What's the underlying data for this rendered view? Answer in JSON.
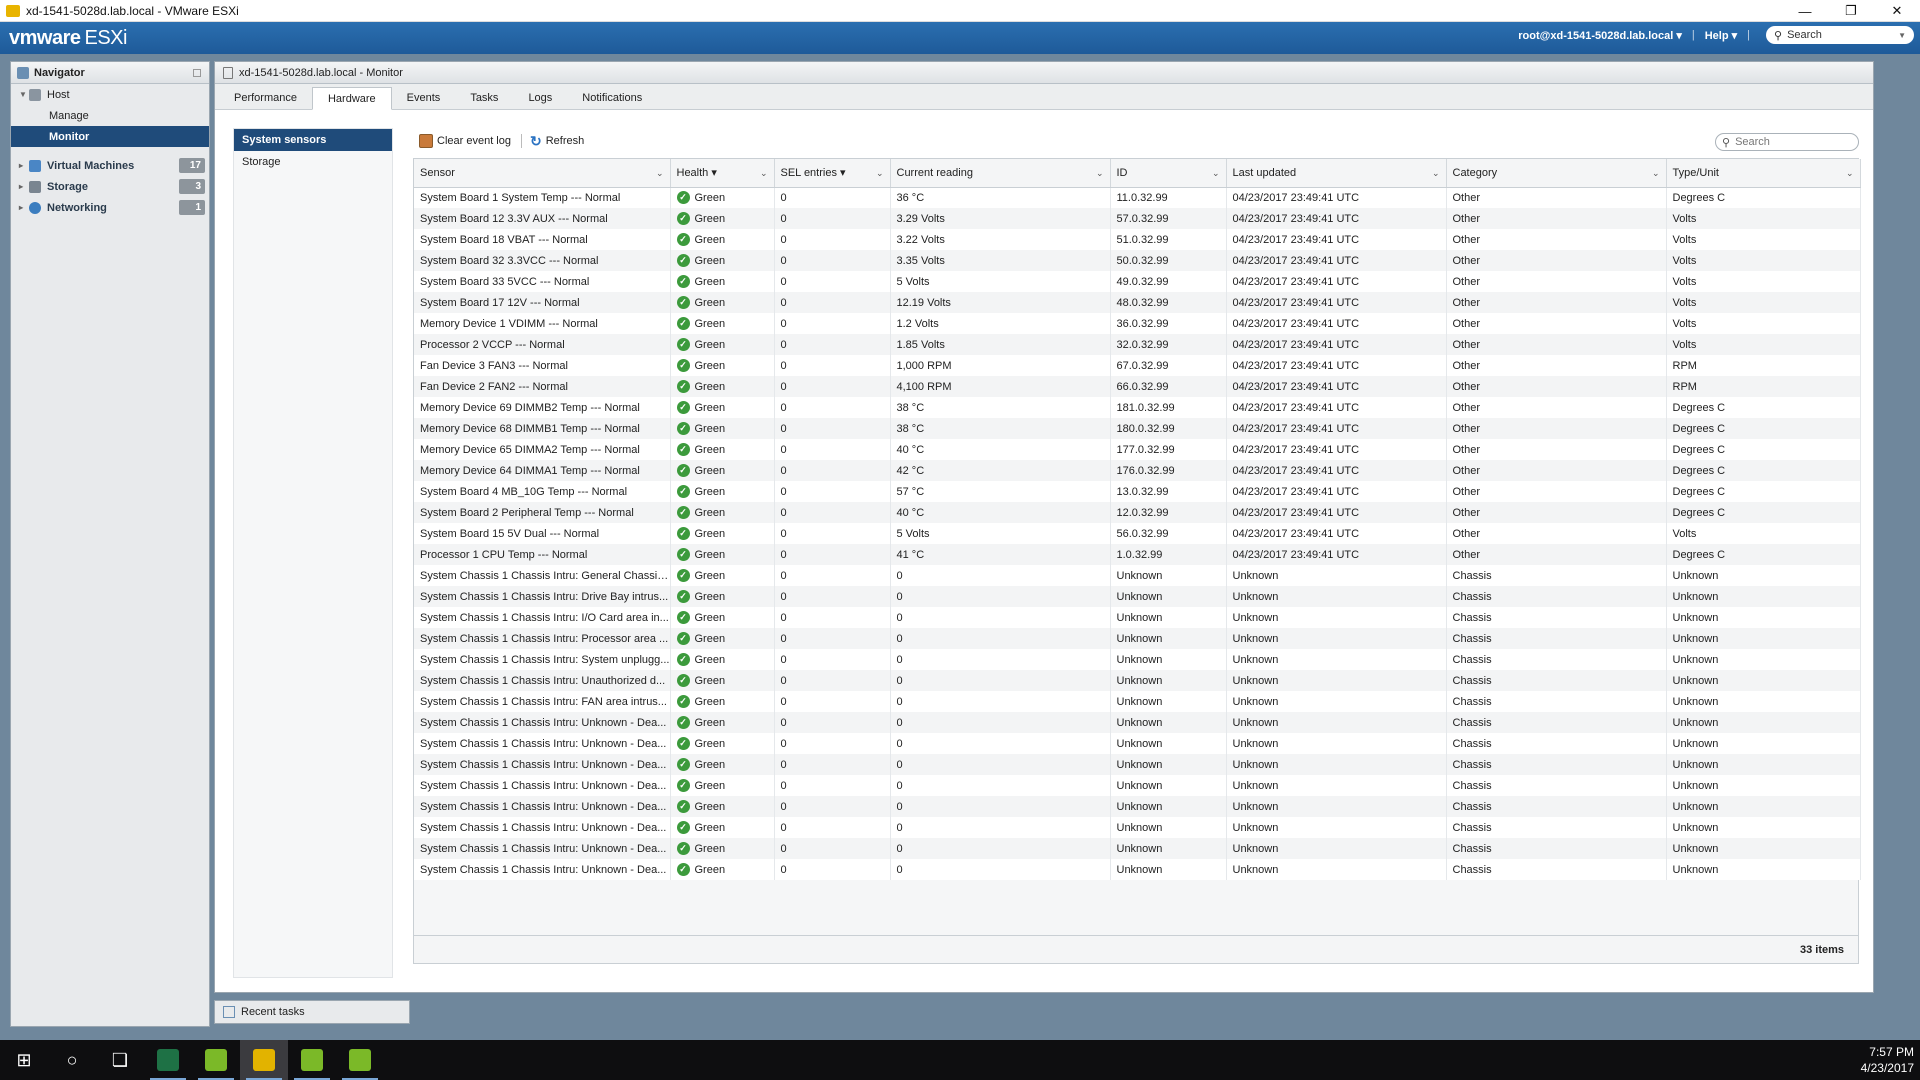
{
  "window": {
    "title": "xd-1541-5028d.lab.local - VMware ESXi",
    "controls": [
      "—",
      "❐",
      "✕"
    ]
  },
  "header": {
    "logo": "vmware",
    "product": "ESXi",
    "user": "root@xd-1541-5028d.lab.local ▾",
    "help": "Help ▾",
    "search_placeholder": "Search"
  },
  "navigator": {
    "title": "Navigator",
    "host": "Host",
    "host_items": [
      "Manage",
      "Monitor"
    ],
    "groups": [
      {
        "label": "Virtual Machines",
        "count": "17",
        "color": "#4a86c5"
      },
      {
        "label": "Storage",
        "count": "3",
        "color": "#7a8590"
      },
      {
        "label": "Networking",
        "count": "1",
        "color": "#3b7dbf"
      }
    ]
  },
  "main": {
    "title": "xd-1541-5028d.lab.local - Monitor",
    "tabs": [
      "Performance",
      "Hardware",
      "Events",
      "Tasks",
      "Logs",
      "Notifications"
    ],
    "side_items": [
      "System sensors",
      "Storage"
    ],
    "toolbar": {
      "clear": "Clear event log",
      "refresh": "Refresh",
      "search_placeholder": "Search"
    },
    "columns": [
      "Sensor",
      "Health ▾",
      "SEL entries ▾",
      "Current reading",
      "ID",
      "Last updated",
      "Category",
      "Type/Unit"
    ],
    "rows": [
      [
        "System Board 1 System Temp --- Normal",
        "Green",
        "0",
        "36 °C",
        "11.0.32.99",
        "04/23/2017 23:49:41 UTC",
        "Other",
        "Degrees C"
      ],
      [
        "System Board 12 3.3V AUX --- Normal",
        "Green",
        "0",
        "3.29 Volts",
        "57.0.32.99",
        "04/23/2017 23:49:41 UTC",
        "Other",
        "Volts"
      ],
      [
        "System Board 18 VBAT --- Normal",
        "Green",
        "0",
        "3.22 Volts",
        "51.0.32.99",
        "04/23/2017 23:49:41 UTC",
        "Other",
        "Volts"
      ],
      [
        "System Board 32 3.3VCC --- Normal",
        "Green",
        "0",
        "3.35 Volts",
        "50.0.32.99",
        "04/23/2017 23:49:41 UTC",
        "Other",
        "Volts"
      ],
      [
        "System Board 33 5VCC --- Normal",
        "Green",
        "0",
        "5 Volts",
        "49.0.32.99",
        "04/23/2017 23:49:41 UTC",
        "Other",
        "Volts"
      ],
      [
        "System Board 17 12V --- Normal",
        "Green",
        "0",
        "12.19 Volts",
        "48.0.32.99",
        "04/23/2017 23:49:41 UTC",
        "Other",
        "Volts"
      ],
      [
        "Memory Device 1 VDIMM --- Normal",
        "Green",
        "0",
        "1.2 Volts",
        "36.0.32.99",
        "04/23/2017 23:49:41 UTC",
        "Other",
        "Volts"
      ],
      [
        "Processor 2 VCCP --- Normal",
        "Green",
        "0",
        "1.85 Volts",
        "32.0.32.99",
        "04/23/2017 23:49:41 UTC",
        "Other",
        "Volts"
      ],
      [
        "Fan Device 3 FAN3 --- Normal",
        "Green",
        "0",
        "1,000 RPM",
        "67.0.32.99",
        "04/23/2017 23:49:41 UTC",
        "Other",
        "RPM"
      ],
      [
        "Fan Device 2 FAN2 --- Normal",
        "Green",
        "0",
        "4,100 RPM",
        "66.0.32.99",
        "04/23/2017 23:49:41 UTC",
        "Other",
        "RPM"
      ],
      [
        "Memory Device 69 DIMMB2 Temp --- Normal",
        "Green",
        "0",
        "38 °C",
        "181.0.32.99",
        "04/23/2017 23:49:41 UTC",
        "Other",
        "Degrees C"
      ],
      [
        "Memory Device 68 DIMMB1 Temp --- Normal",
        "Green",
        "0",
        "38 °C",
        "180.0.32.99",
        "04/23/2017 23:49:41 UTC",
        "Other",
        "Degrees C"
      ],
      [
        "Memory Device 65 DIMMA2 Temp --- Normal",
        "Green",
        "0",
        "40 °C",
        "177.0.32.99",
        "04/23/2017 23:49:41 UTC",
        "Other",
        "Degrees C"
      ],
      [
        "Memory Device 64 DIMMA1 Temp --- Normal",
        "Green",
        "0",
        "42 °C",
        "176.0.32.99",
        "04/23/2017 23:49:41 UTC",
        "Other",
        "Degrees C"
      ],
      [
        "System Board 4 MB_10G Temp --- Normal",
        "Green",
        "0",
        "57 °C",
        "13.0.32.99",
        "04/23/2017 23:49:41 UTC",
        "Other",
        "Degrees C"
      ],
      [
        "System Board 2 Peripheral Temp --- Normal",
        "Green",
        "0",
        "40 °C",
        "12.0.32.99",
        "04/23/2017 23:49:41 UTC",
        "Other",
        "Degrees C"
      ],
      [
        "System Board 15 5V Dual --- Normal",
        "Green",
        "0",
        "5 Volts",
        "56.0.32.99",
        "04/23/2017 23:49:41 UTC",
        "Other",
        "Volts"
      ],
      [
        "Processor 1 CPU Temp --- Normal",
        "Green",
        "0",
        "41 °C",
        "1.0.32.99",
        "04/23/2017 23:49:41 UTC",
        "Other",
        "Degrees C"
      ],
      [
        "System Chassis 1 Chassis Intru: General Chassis...",
        "Green",
        "0",
        "0",
        "Unknown",
        "Unknown",
        "Chassis",
        "Unknown"
      ],
      [
        "System Chassis 1 Chassis Intru: Drive Bay intrus...",
        "Green",
        "0",
        "0",
        "Unknown",
        "Unknown",
        "Chassis",
        "Unknown"
      ],
      [
        "System Chassis 1 Chassis Intru: I/O Card area in...",
        "Green",
        "0",
        "0",
        "Unknown",
        "Unknown",
        "Chassis",
        "Unknown"
      ],
      [
        "System Chassis 1 Chassis Intru: Processor area ...",
        "Green",
        "0",
        "0",
        "Unknown",
        "Unknown",
        "Chassis",
        "Unknown"
      ],
      [
        "System Chassis 1 Chassis Intru: System unplugg...",
        "Green",
        "0",
        "0",
        "Unknown",
        "Unknown",
        "Chassis",
        "Unknown"
      ],
      [
        "System Chassis 1 Chassis Intru: Unauthorized d...",
        "Green",
        "0",
        "0",
        "Unknown",
        "Unknown",
        "Chassis",
        "Unknown"
      ],
      [
        "System Chassis 1 Chassis Intru: FAN area intrus...",
        "Green",
        "0",
        "0",
        "Unknown",
        "Unknown",
        "Chassis",
        "Unknown"
      ],
      [
        "System Chassis 1 Chassis Intru: Unknown - Dea...",
        "Green",
        "0",
        "0",
        "Unknown",
        "Unknown",
        "Chassis",
        "Unknown"
      ],
      [
        "System Chassis 1 Chassis Intru: Unknown - Dea...",
        "Green",
        "0",
        "0",
        "Unknown",
        "Unknown",
        "Chassis",
        "Unknown"
      ],
      [
        "System Chassis 1 Chassis Intru: Unknown - Dea...",
        "Green",
        "0",
        "0",
        "Unknown",
        "Unknown",
        "Chassis",
        "Unknown"
      ],
      [
        "System Chassis 1 Chassis Intru: Unknown - Dea...",
        "Green",
        "0",
        "0",
        "Unknown",
        "Unknown",
        "Chassis",
        "Unknown"
      ],
      [
        "System Chassis 1 Chassis Intru: Unknown - Dea...",
        "Green",
        "0",
        "0",
        "Unknown",
        "Unknown",
        "Chassis",
        "Unknown"
      ],
      [
        "System Chassis 1 Chassis Intru: Unknown - Dea...",
        "Green",
        "0",
        "0",
        "Unknown",
        "Unknown",
        "Chassis",
        "Unknown"
      ],
      [
        "System Chassis 1 Chassis Intru: Unknown - Dea...",
        "Green",
        "0",
        "0",
        "Unknown",
        "Unknown",
        "Chassis",
        "Unknown"
      ],
      [
        "System Chassis 1 Chassis Intru: Unknown - Dea...",
        "Green",
        "0",
        "0",
        "Unknown",
        "Unknown",
        "Chassis",
        "Unknown"
      ]
    ],
    "footer": "33 items"
  },
  "recent_tasks": "Recent tasks",
  "taskbar": {
    "apps": [
      {
        "name": "excel",
        "color": "#1e7145"
      },
      {
        "name": "vmware-1",
        "color": "#7bb928"
      },
      {
        "name": "vmware-2",
        "color": "#e2b300"
      },
      {
        "name": "vmware-3",
        "color": "#7bb928"
      },
      {
        "name": "vmware-4",
        "color": "#7bb928"
      }
    ],
    "time": "7:57 PM",
    "date": "4/23/2017"
  }
}
